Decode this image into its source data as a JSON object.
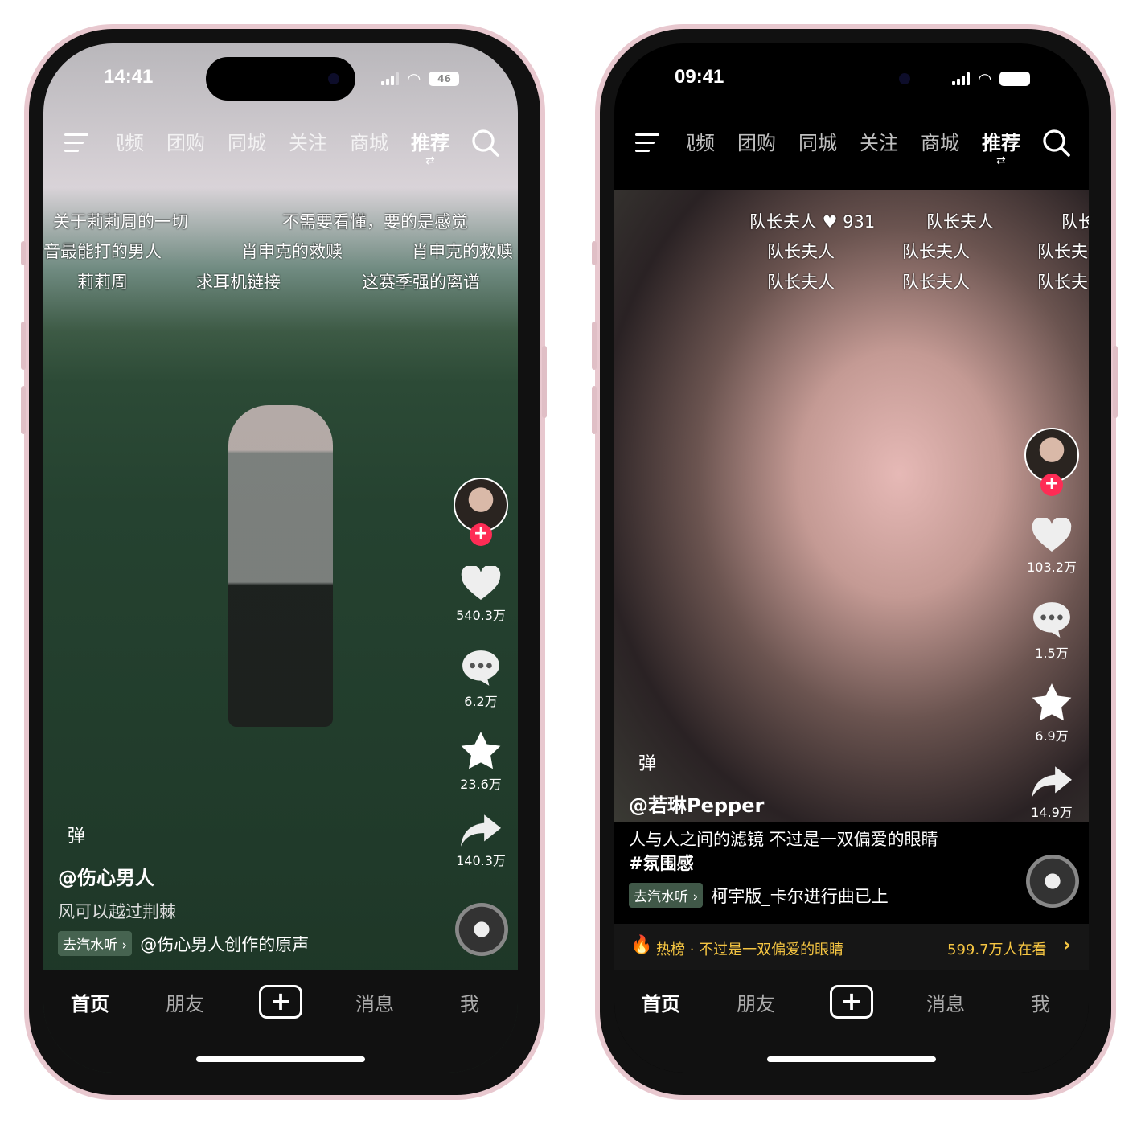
{
  "colors": {
    "accent": "#fe2c55",
    "hot": "#f5c542",
    "frame": "#e8c8cf"
  },
  "phones": [
    {
      "time": "14:41",
      "battery": "46",
      "nav": {
        "tabs": [
          "视频",
          "团购",
          "同城",
          "关注",
          "商城",
          "推荐"
        ],
        "active": "推荐"
      },
      "danmaku": [
        {
          "text": "关于莉莉周的一切",
          "row": 0,
          "col": 0
        },
        {
          "text": "不需要看懂，要的是感觉",
          "row": 0,
          "col": 1
        },
        {
          "text": "音最能打的男人",
          "row": 1,
          "col": 0
        },
        {
          "text": "肖申克的救赎",
          "row": 1,
          "col": 1
        },
        {
          "text": "肖申克的救赎",
          "row": 1,
          "col": 2
        },
        {
          "text": "莉莉周",
          "row": 2,
          "col": 0
        },
        {
          "text": "求耳机链接",
          "row": 2,
          "col": 1
        },
        {
          "text": "这赛季强的离谱",
          "row": 2,
          "col": 2
        }
      ],
      "actions": {
        "likes": "540.3万",
        "comments": "6.2万",
        "favorites": "23.6万",
        "shares": "140.3万"
      },
      "danmaku_toggle": "弹",
      "username": "@伤心男人",
      "description": "风可以越过荆棘",
      "hashtag": "",
      "music": {
        "pill": "去汽水听 ›",
        "title": "@伤心男人创作的原声"
      },
      "hot": null,
      "tabbar": [
        "首页",
        "朋友",
        "+",
        "消息",
        "我"
      ]
    },
    {
      "time": "09:41",
      "battery": "",
      "nav": {
        "tabs": [
          "视频",
          "团购",
          "同城",
          "关注",
          "商城",
          "推荐"
        ],
        "active": "推荐"
      },
      "danmaku": [
        {
          "text": "队长夫人 ♥ 931",
          "row": 0,
          "col": 0
        },
        {
          "text": "队长夫人",
          "row": 0,
          "col": 1
        },
        {
          "text": "队长",
          "row": 0,
          "col": 2
        },
        {
          "text": "队长夫人",
          "row": 1,
          "col": 0
        },
        {
          "text": "队长夫人",
          "row": 1,
          "col": 1
        },
        {
          "text": "队长夫",
          "row": 1,
          "col": 2
        },
        {
          "text": "队长夫人",
          "row": 2,
          "col": 0
        },
        {
          "text": "队长夫人",
          "row": 2,
          "col": 1
        },
        {
          "text": "队长夫",
          "row": 2,
          "col": 2
        }
      ],
      "actions": {
        "likes": "103.2万",
        "comments": "1.5万",
        "favorites": "6.9万",
        "shares": "14.9万"
      },
      "danmaku_toggle": "弹",
      "username": "@若琳Pepper",
      "description": "人与人之间的滤镜 不过是一双偏爱的眼睛",
      "hashtag": "#氛围感",
      "music": {
        "pill": "去汽水听 ›",
        "title": "柯宇版_卡尔进行曲已上"
      },
      "hot": {
        "label": "热榜 · 不过是一双偏爱的眼睛",
        "viewers": "599.7万人在看",
        "chevron": "›"
      },
      "tabbar": [
        "首页",
        "朋友",
        "+",
        "消息",
        "我"
      ]
    }
  ]
}
